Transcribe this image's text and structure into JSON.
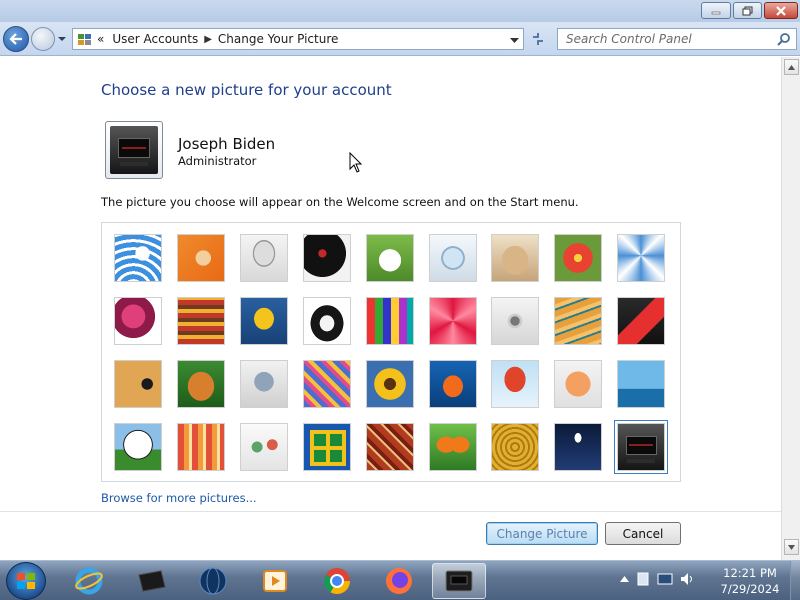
{
  "breadcrumb": {
    "prefix": "«",
    "items": [
      "User Accounts",
      "Change Your Picture"
    ]
  },
  "search": {
    "placeholder": "Search Control Panel"
  },
  "main": {
    "title": "Choose a new picture for your account",
    "user": {
      "name": "Joseph Biden",
      "role": "Administrator"
    },
    "description": "The picture you choose will appear on the Welcome screen and on the Start menu.",
    "pictures": [
      "roller-coaster",
      "starfish",
      "robot-figure",
      "vinyl-record",
      "lucky-cat",
      "gyroscope",
      "kitten",
      "flower",
      "pinwheel",
      "ball",
      "fabric",
      "leaf",
      "dog",
      "crayons",
      "snowflake",
      "jacks",
      "stairs",
      "paper-crane",
      "guitar",
      "puppy",
      "robot",
      "scarf",
      "sunflower",
      "fish",
      "hot-air-balloon",
      "doll",
      "sailboat",
      "soccer-ball",
      "stripes",
      "marbles",
      "window",
      "textile",
      "butterfly",
      "wicker",
      "lighthouse",
      "machine"
    ],
    "selected_picture": "machine",
    "browse_link": "Browse for more pictures...",
    "change_button": "Change Picture",
    "cancel_button": "Cancel"
  },
  "taskbar": {
    "apps": [
      "internet-explorer",
      "device",
      "globe",
      "media",
      "chrome",
      "firefox",
      "control-panel"
    ],
    "clock": {
      "time": "12:21 PM",
      "date": "7/29/2024"
    }
  }
}
